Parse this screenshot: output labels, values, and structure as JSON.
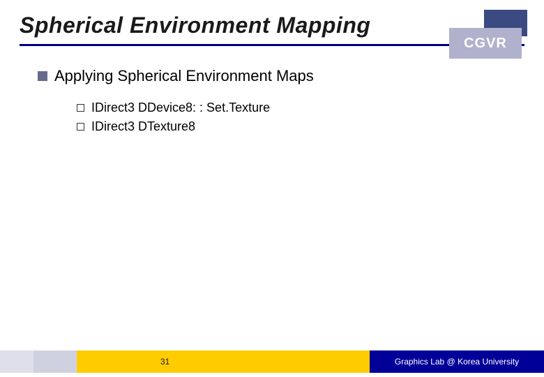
{
  "header": {
    "title": "Spherical Environment Mapping",
    "badge": "CGVR"
  },
  "body": {
    "heading": "Applying Spherical Environment Maps",
    "items": [
      "IDirect3 DDevice8: : Set.Texture",
      "IDirect3 DTexture8"
    ]
  },
  "footer": {
    "page": "31",
    "credit": "Graphics Lab @ Korea University"
  }
}
